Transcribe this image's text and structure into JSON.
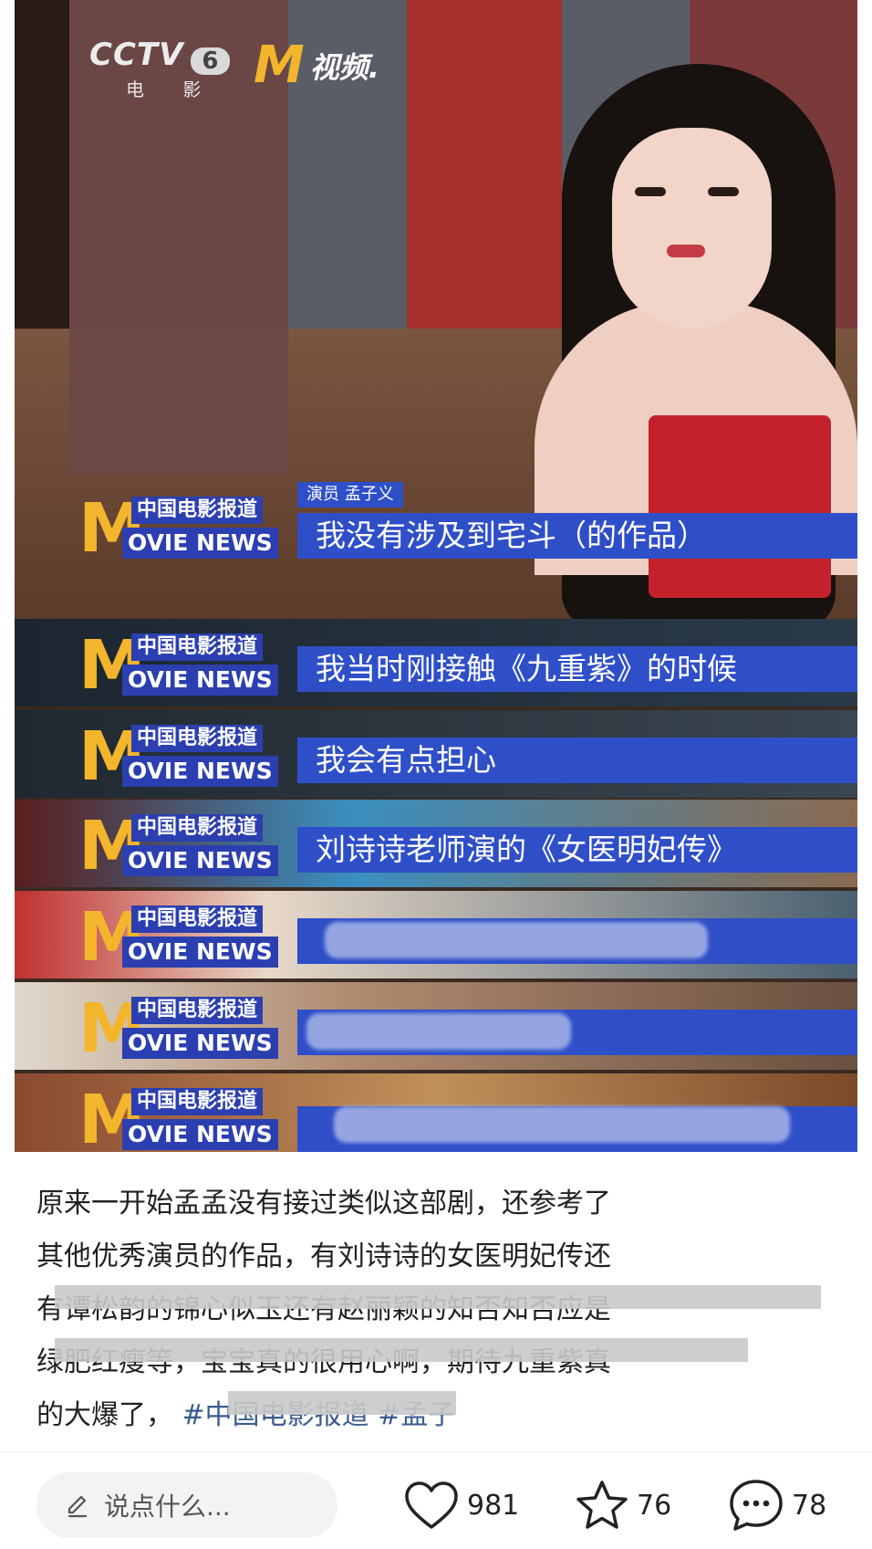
{
  "video": {
    "channel_logo": {
      "word": "CCTV",
      "number": "6",
      "sub": "电 影"
    },
    "m_logo": {
      "letter": "M",
      "text": "视频."
    },
    "speaker_tag": "演员 孟子义",
    "badge": {
      "cn": "中国电影报道",
      "en": "OVIE NEWS",
      "m": "M"
    },
    "captions": [
      "我没有涉及到宅斗（的作品）",
      "我当时刚接触《九重紫》的时候",
      "我会有点担心",
      "刘诗诗老师演的《女医明妃传》",
      "",
      "",
      ""
    ]
  },
  "post": {
    "lines": [
      "原来一开始孟孟没有接过类似这部剧，还参考了",
      "其他优秀演员的作品，有刘诗诗的女医明妃传还",
      "有谭松韵的锦心似玉还有赵丽颖的知否知否应是",
      "绿肥红瘦等，宝宝真的很用心啊，期待九重紫真",
      "的大爆了，"
    ],
    "tags": [
      "#中国电影报道",
      "#孟子"
    ]
  },
  "bottom_bar": {
    "comment_placeholder": "说点什么...",
    "likes": "981",
    "favorites": "76",
    "comments": "78",
    "icons": [
      "edit-icon",
      "heart-icon",
      "star-icon",
      "comment-icon"
    ]
  }
}
